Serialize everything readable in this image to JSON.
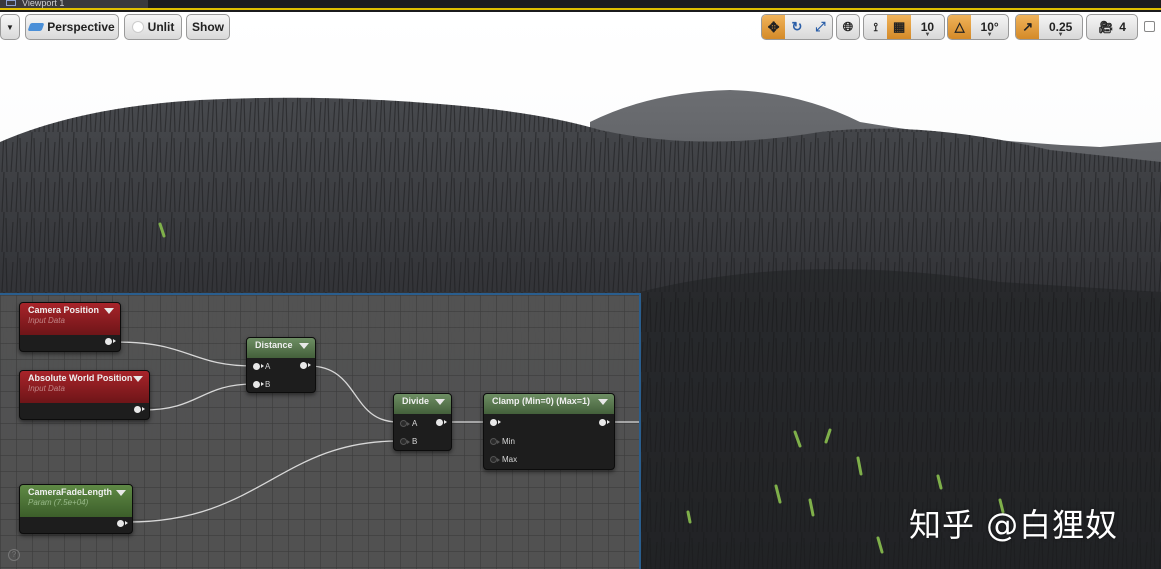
{
  "window": {
    "tab_label": "Viewport 1"
  },
  "toolbar": {
    "view_mode_label": "Perspective",
    "lighting_label": "Unlit",
    "show_label": "Show",
    "grid_snap_value": "10",
    "rotation_snap_value": "10°",
    "scale_snap_value": "0.25",
    "camera_speed_value": "4",
    "active_color": "#e39a33"
  },
  "graph": {
    "nodes": {
      "camera_position": {
        "title": "Camera Position",
        "subtitle": "Input Data"
      },
      "absolute_world_position": {
        "title": "Absolute World Position",
        "subtitle": "Input Data"
      },
      "distance": {
        "title": "Distance",
        "pin_a": "A",
        "pin_b": "B"
      },
      "divide": {
        "title": "Divide",
        "pin_a": "A",
        "pin_b": "B"
      },
      "clamp": {
        "title": "Clamp (Min=0) (Max=1)",
        "pin_min": "Min",
        "pin_max": "Max"
      },
      "camera_fade_length": {
        "title": "CameraFadeLength",
        "subtitle": "Param (7.5e+04)"
      }
    },
    "help_icon": "?"
  },
  "watermark": {
    "text": "知乎 @白狸奴"
  }
}
